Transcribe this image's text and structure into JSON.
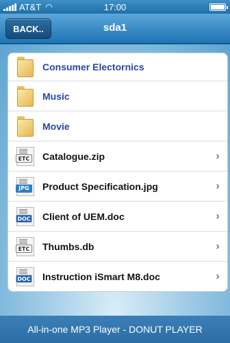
{
  "status_bar": {
    "carrier": "AT&T",
    "time": "17:00"
  },
  "nav": {
    "back_label": "BACK..",
    "title": "sda1"
  },
  "items": [
    {
      "label": "Consumer Electornics",
      "type": "folder",
      "badge": ""
    },
    {
      "label": "Music",
      "type": "folder",
      "badge": ""
    },
    {
      "label": "Movie",
      "type": "folder",
      "badge": ""
    },
    {
      "label": "Catalogue.zip",
      "type": "file",
      "badge": "ETC"
    },
    {
      "label": "Product Specification.jpg",
      "type": "file",
      "badge": "JPG"
    },
    {
      "label": "Client of UEM.doc",
      "type": "file",
      "badge": "DOC"
    },
    {
      "label": "Thumbs.db",
      "type": "file",
      "badge": "ETC"
    },
    {
      "label": "Instruction iSmart M8.doc",
      "type": "file",
      "badge": "DOC"
    }
  ],
  "footer": {
    "text": "All-in-one MP3 Player - DONUT PLAYER"
  },
  "colors": {
    "nav_blue": "#1f74b3",
    "folder_text": "#2a45a0",
    "footer_blue": "#2b6ea6"
  },
  "icons": {
    "folder": "folder-icon",
    "file": "file-icon",
    "chevron": "chevron-right-icon"
  }
}
